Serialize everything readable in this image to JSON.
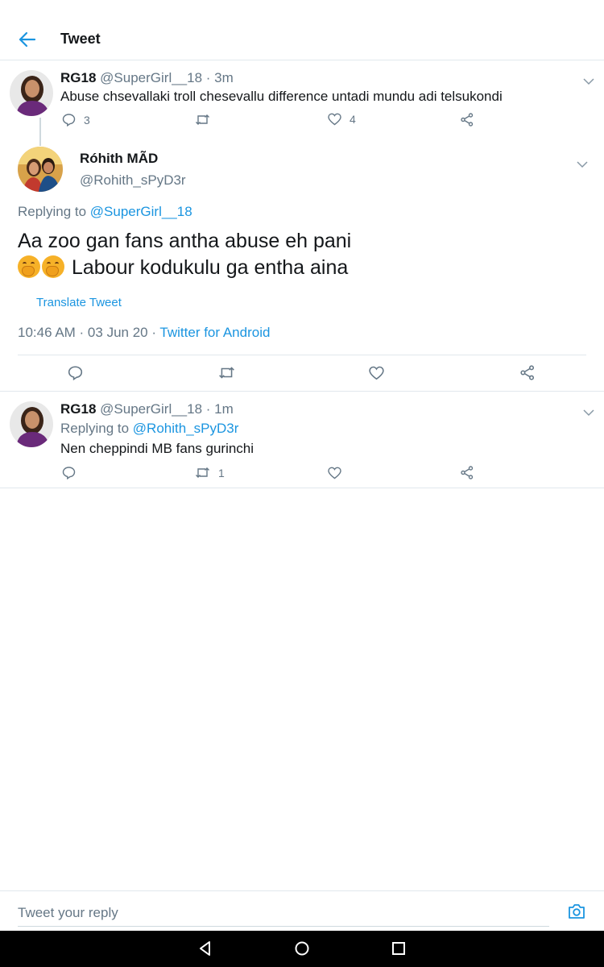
{
  "header": {
    "title": "Tweet"
  },
  "parent_tweet": {
    "name": "RG18",
    "handle": "@SuperGirl__18",
    "time": "· 3m",
    "text": "Abuse chsevallaki troll chesevallu difference untadi mundu adi telsukondi",
    "reply_count": "3",
    "retweet_count": "",
    "like_count": "4"
  },
  "main_tweet": {
    "name": "Róhith MÃD",
    "handle": "@Rohith_sPyD3r",
    "replying_label": "Replying to",
    "replying_handle": "@SuperGirl__18",
    "text_line1": "Aa zoo gan fans antha abuse eh pani",
    "text_line2": "Labour kodukulu ga entha aina",
    "translate_label": "Translate Tweet",
    "time": "10:46 AM · 03 Jun 20 ·",
    "source": "Twitter for Android"
  },
  "reply_tweet": {
    "name": "RG18",
    "handle": "@SuperGirl__18",
    "time": "· 1m",
    "replying_label": "Replying to",
    "replying_handle": "@Rohith_sPyD3r",
    "text": "Nen cheppindi MB fans gurinchi",
    "reply_count": "",
    "retweet_count": "1",
    "like_count": ""
  },
  "reply_bar": {
    "placeholder": "Tweet your reply"
  },
  "colors": {
    "accent": "#1b95e0",
    "muted": "#657786",
    "text": "#14171a",
    "divider": "#e1e8ed"
  }
}
